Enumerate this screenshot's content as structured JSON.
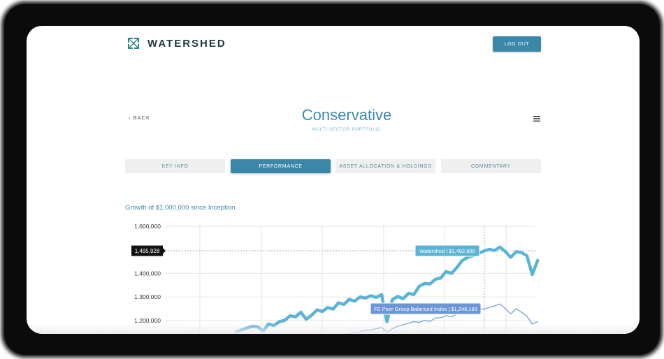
{
  "brand": {
    "name": "WATERSHED",
    "logo_icon": "watershed-logo-icon",
    "accent": "#3b87a8"
  },
  "header": {
    "logout_label": "LOG OUT"
  },
  "nav": {
    "back_label": "BACK",
    "back_icon": "chevron-left-icon",
    "menu_icon": "hamburger-menu-icon"
  },
  "page": {
    "title": "Conservative",
    "subtitle": "MULTI-SECTOR PORTFOLIO"
  },
  "tabs": [
    {
      "label": "KEY INFO",
      "active": false
    },
    {
      "label": "PERFORMANCE",
      "active": true
    },
    {
      "label": "ASSET ALLOCATION & HOLDINGS",
      "active": false
    },
    {
      "label": "COMMENTARY",
      "active": false
    }
  ],
  "chart_data": {
    "type": "line",
    "title": "Growth of $1,000,000 since Inception",
    "y_ticks": [
      "1,600,000",
      "1,400,000",
      "1,300,000",
      "1,200,000"
    ],
    "ylim": [
      1150000,
      1600000
    ],
    "grid": true,
    "crosshair_label": "1,495,928",
    "series": [
      {
        "name": "Watershed",
        "tooltip": "Watershed | $1,492,886",
        "color": "#5bb3d6",
        "values": [
          1150000,
          1160000,
          1168000,
          1175000,
          1172000,
          1155000,
          1185000,
          1178000,
          1195000,
          1200000,
          1220000,
          1215000,
          1235000,
          1205000,
          1222000,
          1245000,
          1238000,
          1255000,
          1248000,
          1275000,
          1268000,
          1290000,
          1282000,
          1300000,
          1295000,
          1305000,
          1298000,
          1310000,
          1195000,
          1288000,
          1302000,
          1292000,
          1315000,
          1310000,
          1345000,
          1357000,
          1355000,
          1375000,
          1380000,
          1408000,
          1400000,
          1425000,
          1455000,
          1468000,
          1475000,
          1485000,
          1495000,
          1502000,
          1497000,
          1512000,
          1493000,
          1468000,
          1492000,
          1488000,
          1475000,
          1395000,
          1455000
        ]
      },
      {
        "name": "FE Peer Group Balanced Index",
        "tooltip": "FE Peer Group Balanced Index | $1,248,183",
        "color": "#6d96d6",
        "values": [
          null,
          null,
          null,
          null,
          null,
          null,
          null,
          null,
          null,
          null,
          null,
          null,
          null,
          null,
          null,
          null,
          null,
          null,
          null,
          null,
          1140000,
          1145000,
          1148000,
          1152000,
          1158000,
          1160000,
          1165000,
          1170000,
          1150000,
          1165000,
          1175000,
          1182000,
          1188000,
          1195000,
          1192000,
          1200000,
          1196000,
          1210000,
          1212000,
          1220000,
          1215000,
          1228000,
          1235000,
          1240000,
          1245000,
          1250000,
          1248000,
          1255000,
          1262000,
          1270000,
          1250000,
          1228000,
          1250000,
          1235000,
          1218000,
          1185000,
          1195000
        ]
      }
    ]
  }
}
